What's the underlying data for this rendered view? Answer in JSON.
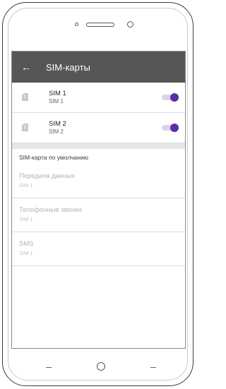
{
  "appbar": {
    "back_icon": "←",
    "title": "SIM-карты"
  },
  "sims": [
    {
      "slot": "1",
      "name": "SIM 1",
      "sub": "SIM 1",
      "enabled": true
    },
    {
      "slot": "2",
      "name": "SIM 2",
      "sub": "SIM 2",
      "enabled": true
    }
  ],
  "default_section": {
    "header": "SIM-карта по умолчанию",
    "items": [
      {
        "title": "Передача данных",
        "sub": "SIM 1"
      },
      {
        "title": "Телефонные звонки",
        "sub": "SIM 1"
      },
      {
        "title": "SMS",
        "sub": "SIM 1"
      }
    ]
  },
  "colors": {
    "appbar": "#565656",
    "accent": "#5b2ea6"
  },
  "icons": {
    "back": "arrow-left-icon",
    "sim": "sim-card-icon",
    "nav_back": "nav-back-icon",
    "nav_home": "nav-home-icon",
    "nav_recents": "nav-recents-icon"
  }
}
